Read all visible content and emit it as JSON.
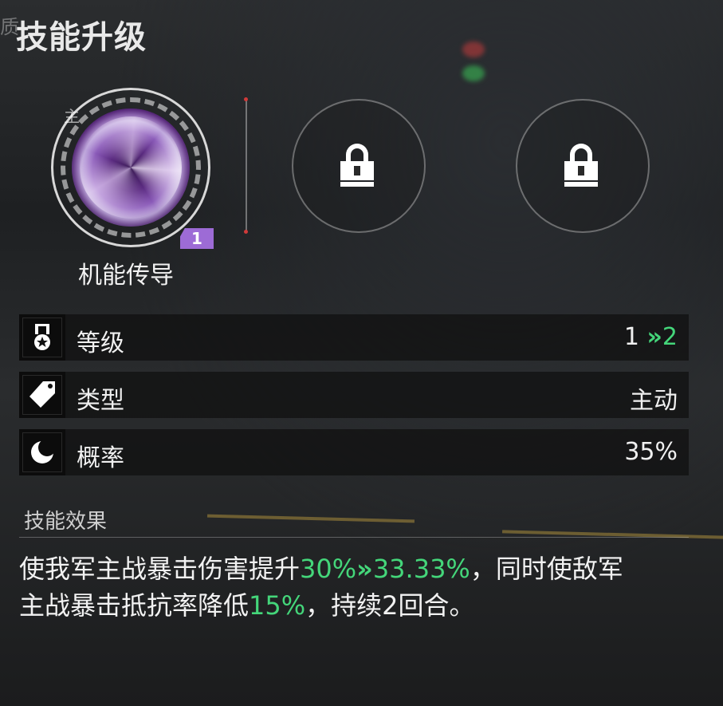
{
  "header": {
    "side_tab": "质",
    "title": "技能升级"
  },
  "skills": {
    "main": {
      "tag": "主",
      "name": "机能传导",
      "level_badge": "1",
      "icon": "purple-vortex-icon"
    },
    "locked_slots": [
      {
        "icon": "lock-icon"
      },
      {
        "icon": "lock-icon"
      }
    ]
  },
  "stats": [
    {
      "icon": "medal-icon",
      "label": "等级",
      "value_from": "1",
      "arrow": "»",
      "value_to": "2"
    },
    {
      "icon": "tag-icon",
      "label": "类型",
      "value": "主动"
    },
    {
      "icon": "crescent-moon-icon",
      "label": "概率",
      "value": "35%"
    }
  ],
  "effect": {
    "title": "技能效果",
    "line1_a": "使我军主战暴击伤害提升",
    "line1_from": "30%",
    "line1_arrow": "»",
    "line1_to": "33.33%",
    "line1_b": "，同时使敌军",
    "line2_a": "主战暴击抵抗率降低",
    "line2_val": "15%",
    "line2_b": "，持续2回合。"
  },
  "colors": {
    "highlight_green": "#44d67a",
    "badge_purple": "#9d6bd6"
  }
}
